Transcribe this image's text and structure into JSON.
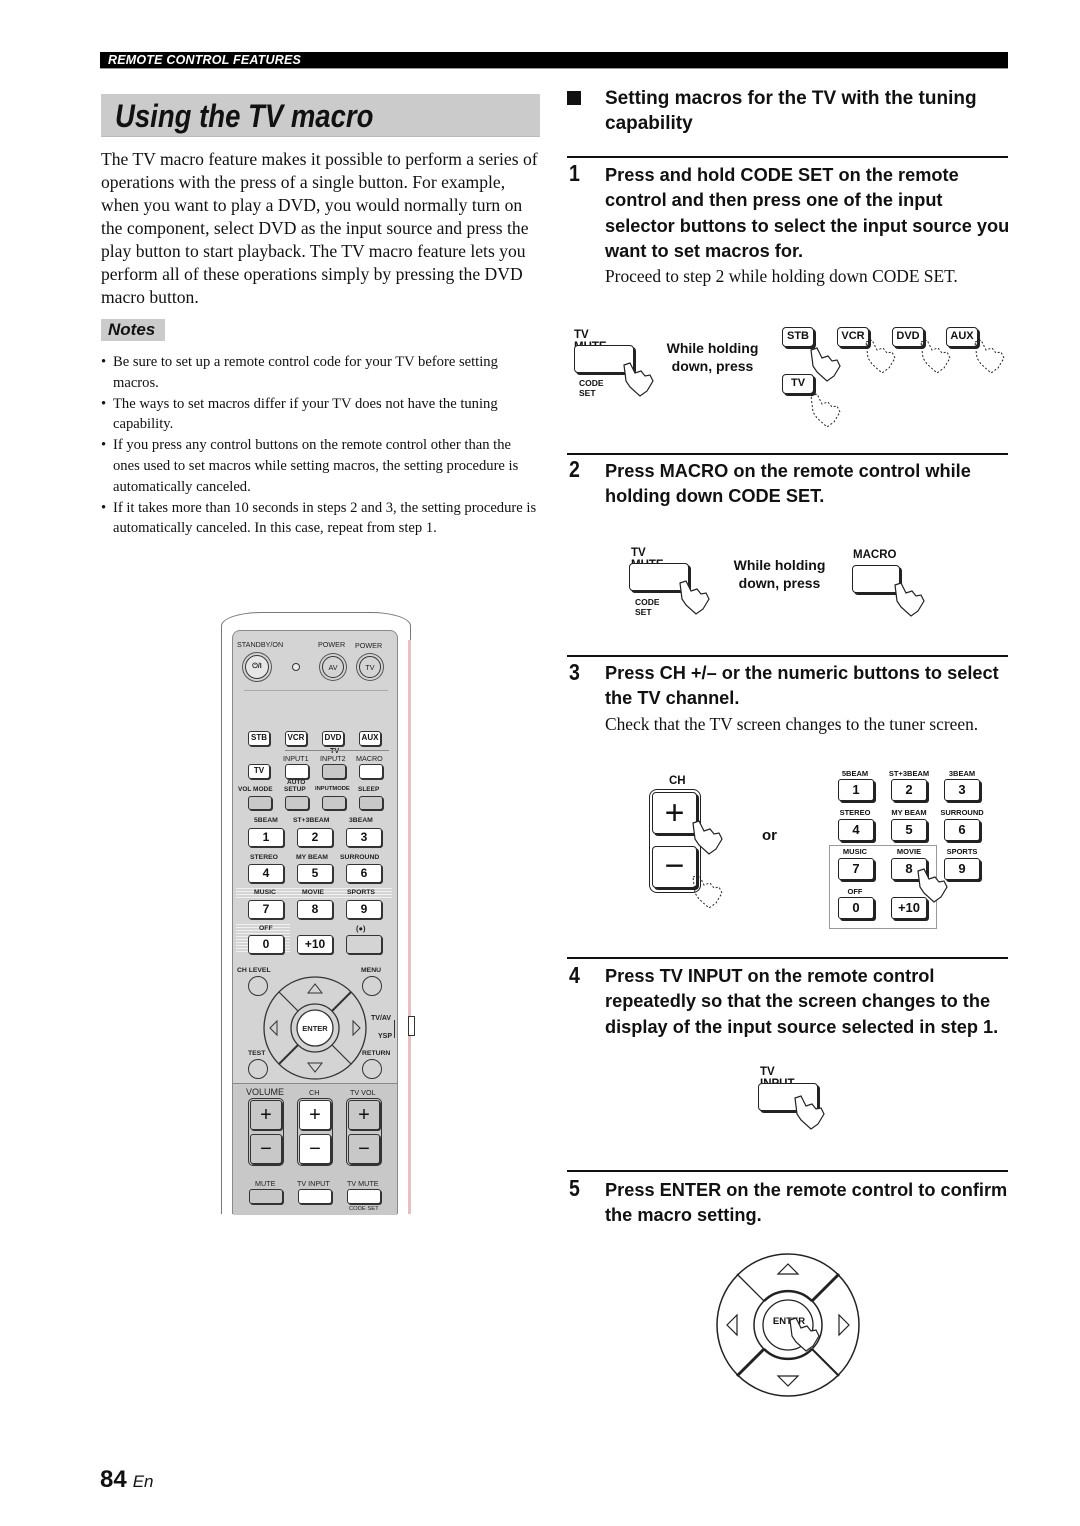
{
  "header": {
    "section_label": "REMOTE CONTROL FEATURES"
  },
  "left": {
    "title": "Using the TV macro",
    "intro": "The TV macro feature makes it possible to perform a series of operations with the press of a single button. For example, when you want to play a DVD, you would normally turn on the component, select DVD as the input source and press the play button to start playback. The TV macro feature lets you perform all of these operations simply by pressing the DVD macro button.",
    "notes_label": "Notes",
    "notes": [
      "Be sure to set up a remote control code for your TV before setting macros.",
      "The ways to set macros differ if your TV does not have the tuning capability.",
      "If you press any control buttons on the remote control other than the ones used to set macros while setting macros, the setting procedure is automatically canceled.",
      "If it takes more than 10 seconds in steps 2 and 3, the setting procedure is automatically canceled. In this case, repeat from step 1."
    ]
  },
  "remote": {
    "standby_label": "STANDBY/ON",
    "standby_symbol": "⏻/I",
    "power_av_label": "POWER",
    "power_tv_label": "POWER",
    "av": "AV",
    "tv": "TV",
    "inputs": [
      "STB",
      "VCR",
      "DVD",
      "AUX"
    ],
    "tv_group_label": "TV",
    "tv_button": "TV",
    "row2_labels": [
      "INPUT1",
      "INPUT2",
      "MACRO"
    ],
    "row3_labels": [
      "VOL MODE",
      "AUTO",
      "SETUP",
      "INPUTMODE",
      "SLEEP"
    ],
    "num_labels": [
      "5BEAM",
      "ST+3BEAM",
      "3BEAM",
      "STEREO",
      "MY BEAM",
      "SURROUND",
      "MUSIC",
      "MOVIE",
      "SPORTS",
      "OFF",
      "",
      "(●)"
    ],
    "num_keys": [
      "1",
      "2",
      "3",
      "4",
      "5",
      "6",
      "7",
      "8",
      "9",
      "0",
      "+10",
      ""
    ],
    "ch_level": "CH LEVEL",
    "menu": "MENU",
    "enter": "ENTER",
    "tvav": "TV/AV",
    "ysp": "YSP",
    "test": "TEST",
    "return": "RETURN",
    "volume": "VOLUME",
    "ch": "CH",
    "tv_vol": "TV VOL",
    "plus": "+",
    "minus": "−",
    "bottom_labels": [
      "MUTE",
      "TV INPUT",
      "TV MUTE"
    ],
    "code_set": "CODE SET"
  },
  "right": {
    "subheading": "Setting macros for the TV with the tuning capability",
    "steps": [
      {
        "num": "1",
        "title": "Press and hold CODE SET on the remote control and then press one of the input selector buttons to select the input source you want to set macros for.",
        "body": "Proceed to step 2 while holding down CODE SET."
      },
      {
        "num": "2",
        "title": "Press MACRO on the remote control while holding down CODE SET.",
        "body": ""
      },
      {
        "num": "3",
        "title": "Press CH +/– or the numeric buttons to select the TV channel.",
        "body": "Check that the TV screen changes to the tuner screen."
      },
      {
        "num": "4",
        "title": "Press TV INPUT on the remote control repeatedly so that the screen changes to the display of the input source selected in step 1.",
        "body": ""
      },
      {
        "num": "5",
        "title": "Press ENTER on the remote control to confirm the macro setting.",
        "body": ""
      }
    ],
    "fig1": {
      "tv_mute": "TV MUTE",
      "code_set": "CODE SET",
      "while_holding": "While holding",
      "down_press": "down, press",
      "inputs": [
        "STB",
        "VCR",
        "DVD",
        "AUX"
      ],
      "tv": "TV"
    },
    "fig2": {
      "tv_mute": "TV MUTE",
      "code_set": "CODE SET",
      "while_holding": "While holding",
      "down_press": "down, press",
      "macro": "MACRO"
    },
    "fig3": {
      "ch": "CH",
      "plus": "+",
      "minus": "−",
      "or": "or",
      "num_labels": [
        "5BEAM",
        "ST+3BEAM",
        "3BEAM",
        "STEREO",
        "MY BEAM",
        "SURROUND",
        "MUSIC",
        "MOVIE",
        "SPORTS",
        "OFF"
      ],
      "num_keys": [
        "1",
        "2",
        "3",
        "4",
        "5",
        "6",
        "7",
        "8",
        "9",
        "0",
        "+10"
      ]
    },
    "fig4": {
      "tv_input": "TV INPUT"
    },
    "fig5": {
      "enter": "ENTER"
    }
  },
  "footer": {
    "page_number": "84",
    "language": "En"
  }
}
